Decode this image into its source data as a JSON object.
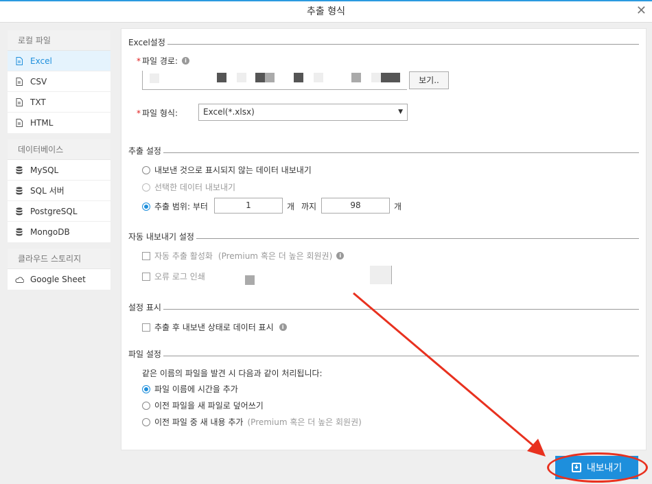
{
  "window": {
    "title": "추출 형식",
    "close_icon": "close-icon"
  },
  "sidebar": {
    "local": {
      "title": "로컬 파일",
      "items": [
        {
          "label": "Excel",
          "icon": "file-icon",
          "active": true
        },
        {
          "label": "CSV",
          "icon": "file-icon"
        },
        {
          "label": "TXT",
          "icon": "file-icon"
        },
        {
          "label": "HTML",
          "icon": "file-icon"
        }
      ]
    },
    "database": {
      "title": "데이터베이스",
      "items": [
        {
          "label": "MySQL",
          "icon": "database-icon"
        },
        {
          "label": "SQL 서버",
          "icon": "database-icon"
        },
        {
          "label": "PostgreSQL",
          "icon": "database-icon"
        },
        {
          "label": "MongoDB",
          "icon": "database-icon"
        }
      ]
    },
    "cloud": {
      "title": "클라우드 스토리지",
      "items": [
        {
          "label": "Google Sheet",
          "icon": "cloud-icon"
        }
      ]
    }
  },
  "excel_settings": {
    "section_title": "Excel설정",
    "path_label": "파일 경로:",
    "browse_label": "보기..",
    "format_label": "파일 형식:",
    "format_value": "Excel(*.xlsx)"
  },
  "extract_settings": {
    "section_title": "추출 설정",
    "opt1": "내보낸 것으로 표시되지 않는 데이터 내보내기",
    "opt2": "선택한 데이터 내보내기",
    "opt3_label": "추출 범위: 부터",
    "range_from": "1",
    "unit1": "개",
    "until": "까지",
    "range_to": "98",
    "unit2": "개"
  },
  "auto_export": {
    "section_title": "자동 내보내기 설정",
    "enable_label": "자동 추출 활성화",
    "premium_note": "(Premium 혹은 더 높은 회원권)",
    "error_log_label": "오류 로그 인쇄"
  },
  "display_settings": {
    "section_title": "설정 표시",
    "show_label": "추출 후 내보낸 상태로 데이터 표시"
  },
  "file_settings": {
    "section_title": "파일 설정",
    "desc": "같은 이름의 파일을 발견 시 다음과 같이 처리됩니다:",
    "opt1": "파일 이름에 시간을 추가",
    "opt2": "이전 파일을 새 파일로 덮어쓰기",
    "opt3": "이전 파일 중 새 내용 추가",
    "opt3_note": "(Premium 혹은 더 높은 회원권)"
  },
  "footer": {
    "export_label": "내보내기",
    "export_icon": "export-icon"
  },
  "colors": {
    "accent": "#1e8fdc",
    "annotation": "#e8311f"
  }
}
